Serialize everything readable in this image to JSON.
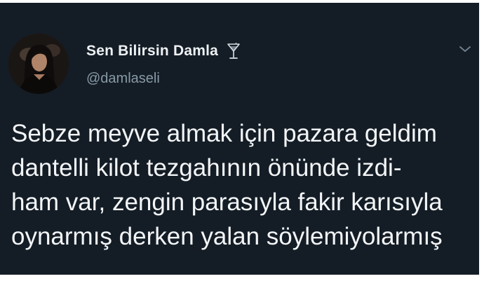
{
  "tweet": {
    "display_name": "Sen Bilirsin Damla",
    "handle": "@damlaseli",
    "name_emoji_icon": "cocktail-glass-icon",
    "avatar_icon": "profile-photo",
    "menu_icon": "chevron-down-icon",
    "text_lines": [
      "Sebze meyve almak için pazara geldim",
      "dantelli kilot tezgahının önünde izdi-",
      "ham var, zengin parasıyla fakir karısıyla",
      "oynarmış derken yalan söylemiyolarmış"
    ]
  },
  "colors": {
    "card_background": "#141d26",
    "name_text": "#eef1f3",
    "handle_text": "#8899a6",
    "body_text": "#f3f5f7",
    "page_background": "#ffffff"
  }
}
